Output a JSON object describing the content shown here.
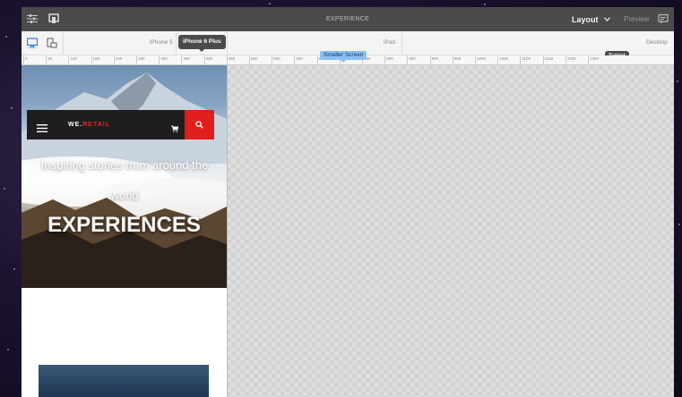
{
  "topbar": {
    "title": "EXPERIENCE",
    "layout_label": "Layout",
    "preview_label": "Preview"
  },
  "devices": {
    "iphone5": "iPhone 5",
    "iphone6plus": "iPhone 6 Plus",
    "ipad": "iPad",
    "desktop": "Desktop",
    "tablet_marker": "Tablet",
    "smaller_screen": "Smaller Screen"
  },
  "ruler_ticks": [
    "0",
    "50",
    "100",
    "150",
    "200",
    "250",
    "300",
    "350",
    "400",
    "450",
    "500",
    "550",
    "600",
    "650",
    "700",
    "750",
    "800",
    "850",
    "900",
    "950",
    "1000",
    "1050",
    "1100",
    "1150",
    "1200",
    "1250"
  ],
  "site": {
    "brand_prefix": "WE.",
    "brand_suffix": "RETAIL",
    "tagline_line1": "Inspiring stories from around the",
    "tagline_line2": "world",
    "headline": "EXPERIENCES"
  },
  "colors": {
    "accent_red": "#e21d1d",
    "toolbar": "#4b4b4b",
    "smaller_screen_badge": "#8bc0f5"
  }
}
